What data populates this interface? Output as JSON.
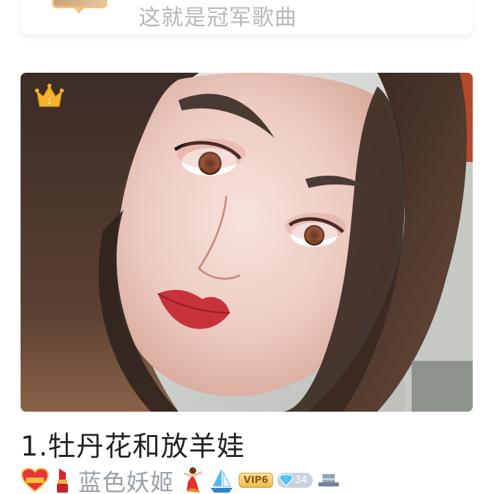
{
  "top_card": {
    "title": "这就是冠军歌曲"
  },
  "main_post": {
    "rank_badge_icon": "crown-icon",
    "rank_number": "1",
    "song_title": "1.牡丹花和放羊娃"
  },
  "user": {
    "name": "蓝色妖姬",
    "vip_label": "VIP6",
    "diamond_count": "34",
    "badges": [
      "heart-badge-icon",
      "lipstick-icon",
      "dancer-icon",
      "sailboat-icon",
      "vip-badge",
      "diamond-badge",
      "hat-icon"
    ]
  },
  "colors": {
    "accent_red": "#e8514b",
    "gold": "#f3c27b",
    "username_gray": "#9aa0a8"
  }
}
